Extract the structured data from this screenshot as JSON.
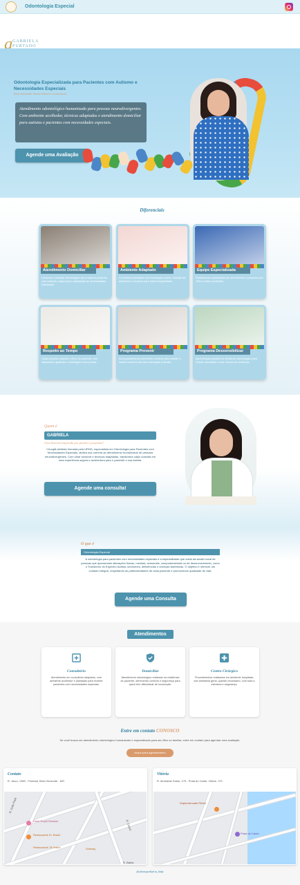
{
  "topbar": {
    "title": "Odontologia Especial",
    "instagram_icon": "instagram-icon"
  },
  "logo": {
    "initial": "g",
    "line1": "GABRIELA",
    "line2": "FURTADO",
    "line3": "ODONTOLOGIA ESPECIAL"
  },
  "hero": {
    "heading": "Odontologia Especializada para Pacientes com Autismo e Necessidades Especiais",
    "subheading": "Belo Horizonte Santa Helena e Zona Norte",
    "box_text": "Atendimento odontológico humanizado para pessoas neurodivergentes. Com ambiente acolhedor, técnicas adaptadas e atendimento domiciliar para autistas e pacientes com necessidades especiais.",
    "button": "Agende uma Avaliação",
    "hand_colors": [
      "#e84c3d",
      "#4a86c8",
      "#f2c230",
      "#48a64a",
      "#f6e1c6",
      "#e84c3d",
      "#4a86c8",
      "#f2c230",
      "#48a64a",
      "#e84c3d",
      "#4a86c8",
      "#f2c230",
      "#48a64a",
      "#e84c3d"
    ]
  },
  "diferenciais": {
    "title": "Diferenciais",
    "cards": [
      {
        "label": "Atendimento Domiciliar",
        "desc": "Levamos o cuidado odontológico até a casa do paciente, com conforto, segurança e adaptação às necessidades individuais.",
        "tone": "#8a7f74"
      },
      {
        "label": "Ambiente Adaptado",
        "desc": "Consultório planejado com iluminação suave, redução de estímulos e recursos para maior tranquilidade.",
        "tone": "#f3d7d3"
      },
      {
        "label": "Equipe Especializada",
        "desc": "Profissionais capacitados em atendimento a pessoas com TEA e outras condições.",
        "tone": "#3b69b5"
      },
      {
        "label": "Respeito ao Tempo",
        "desc": "Cada consulta respeita o ritmo do paciente, com adaptações graduais e abordagem sem pressa.",
        "tone": "#eceae6"
      },
      {
        "label": "Programa Prevenir",
        "desc": "Acompanhamento preventivo contínuo para manter a saúde bucal em dia com orientação à família.",
        "tone": "#d9d4cf"
      },
      {
        "label": "Programa Dessensibilizar",
        "desc": "Aproximação gradual ao ambiente odontológico para reduzir ansiedade e criar vínculo de confiança.",
        "tone": "#bcd7c0"
      }
    ]
  },
  "quem": {
    "small": "Quem é",
    "name": "GABRIELA",
    "sub": "Uma história inspirada por paixão e propósito!",
    "text": "Cirurgiã-dentista formada pela UFMG, especialista em Odontologia para Pacientes com Necessidades Especiais, dedica sua carreira ao atendimento humanizado de pessoas neurodivergentes. Com olhar sensível e técnicas adaptadas, transforma cada consulta em uma experiência segura e acolhedora para o paciente e sua família.",
    "button": "Agende uma consulta!"
  },
  "oque": {
    "small": "O que é",
    "band": "Odontologia Especial",
    "text": "A odontologia para pacientes com necessidades especiais é a especialidade que cuida da saúde bucal de pessoas que apresentam alterações físicas, mentais, sensoriais, comportamentais ou de desenvolvimento, como o Transtorno do Espectro Autista, síndromes, deficiências e doenças sistêmicas. O objetivo é oferecer um cuidado integral, respeitando as particularidades de cada paciente e promovendo qualidade de vida.",
    "button": "Agende uma Consulta"
  },
  "atendimentos": {
    "title": "Atendimentos",
    "cards": [
      {
        "icon": "consultorio-icon",
        "title": "Consultório",
        "desc": "Atendimento em consultório adaptado, com ambiente acolhedor e planejado para receber pacientes com necessidades especiais."
      },
      {
        "icon": "shield-check-icon",
        "title": "Domiciliar",
        "desc": "Atendimento odontológico realizado na residência do paciente, oferecendo conforto e segurança para quem tem dificuldade de locomoção."
      },
      {
        "icon": "medical-cross-icon",
        "title": "Centro Cirúrgico",
        "desc": "Procedimentos realizados em ambiente hospitalar, sob anestesia geral, quando necessário, com toda a estrutura e segurança."
      }
    ]
  },
  "contato": {
    "title_a": "Entre em contato",
    "title_b": "CONOSCO",
    "text": "Se você busca um atendimento odontológico humanizado e especializado para seu filho ou familiar, entre em contato para agendar uma avaliação.",
    "button": "clique para agendamento",
    "maps": [
      {
        "title": "Contato",
        "address": "R. Jacuí, 1380 - Floresta, Belo Horizonte - MG",
        "labels": [
          "R. Grão Pará",
          "Hotel Royal Savassi",
          "Restaurante Sr. Brasil",
          "Restaurante 78 Graus",
          "Subway",
          "R. Bahia",
          "R. Ceará"
        ]
      },
      {
        "title": "Vitória",
        "address": "R. Almirante Soido, 175 - Praia do Canto, Vitória - ES",
        "labels": [
          "Supermercado Perim",
          "Praia do Canto"
        ]
      }
    ]
  },
  "footer": "@odontopediatria_baby"
}
